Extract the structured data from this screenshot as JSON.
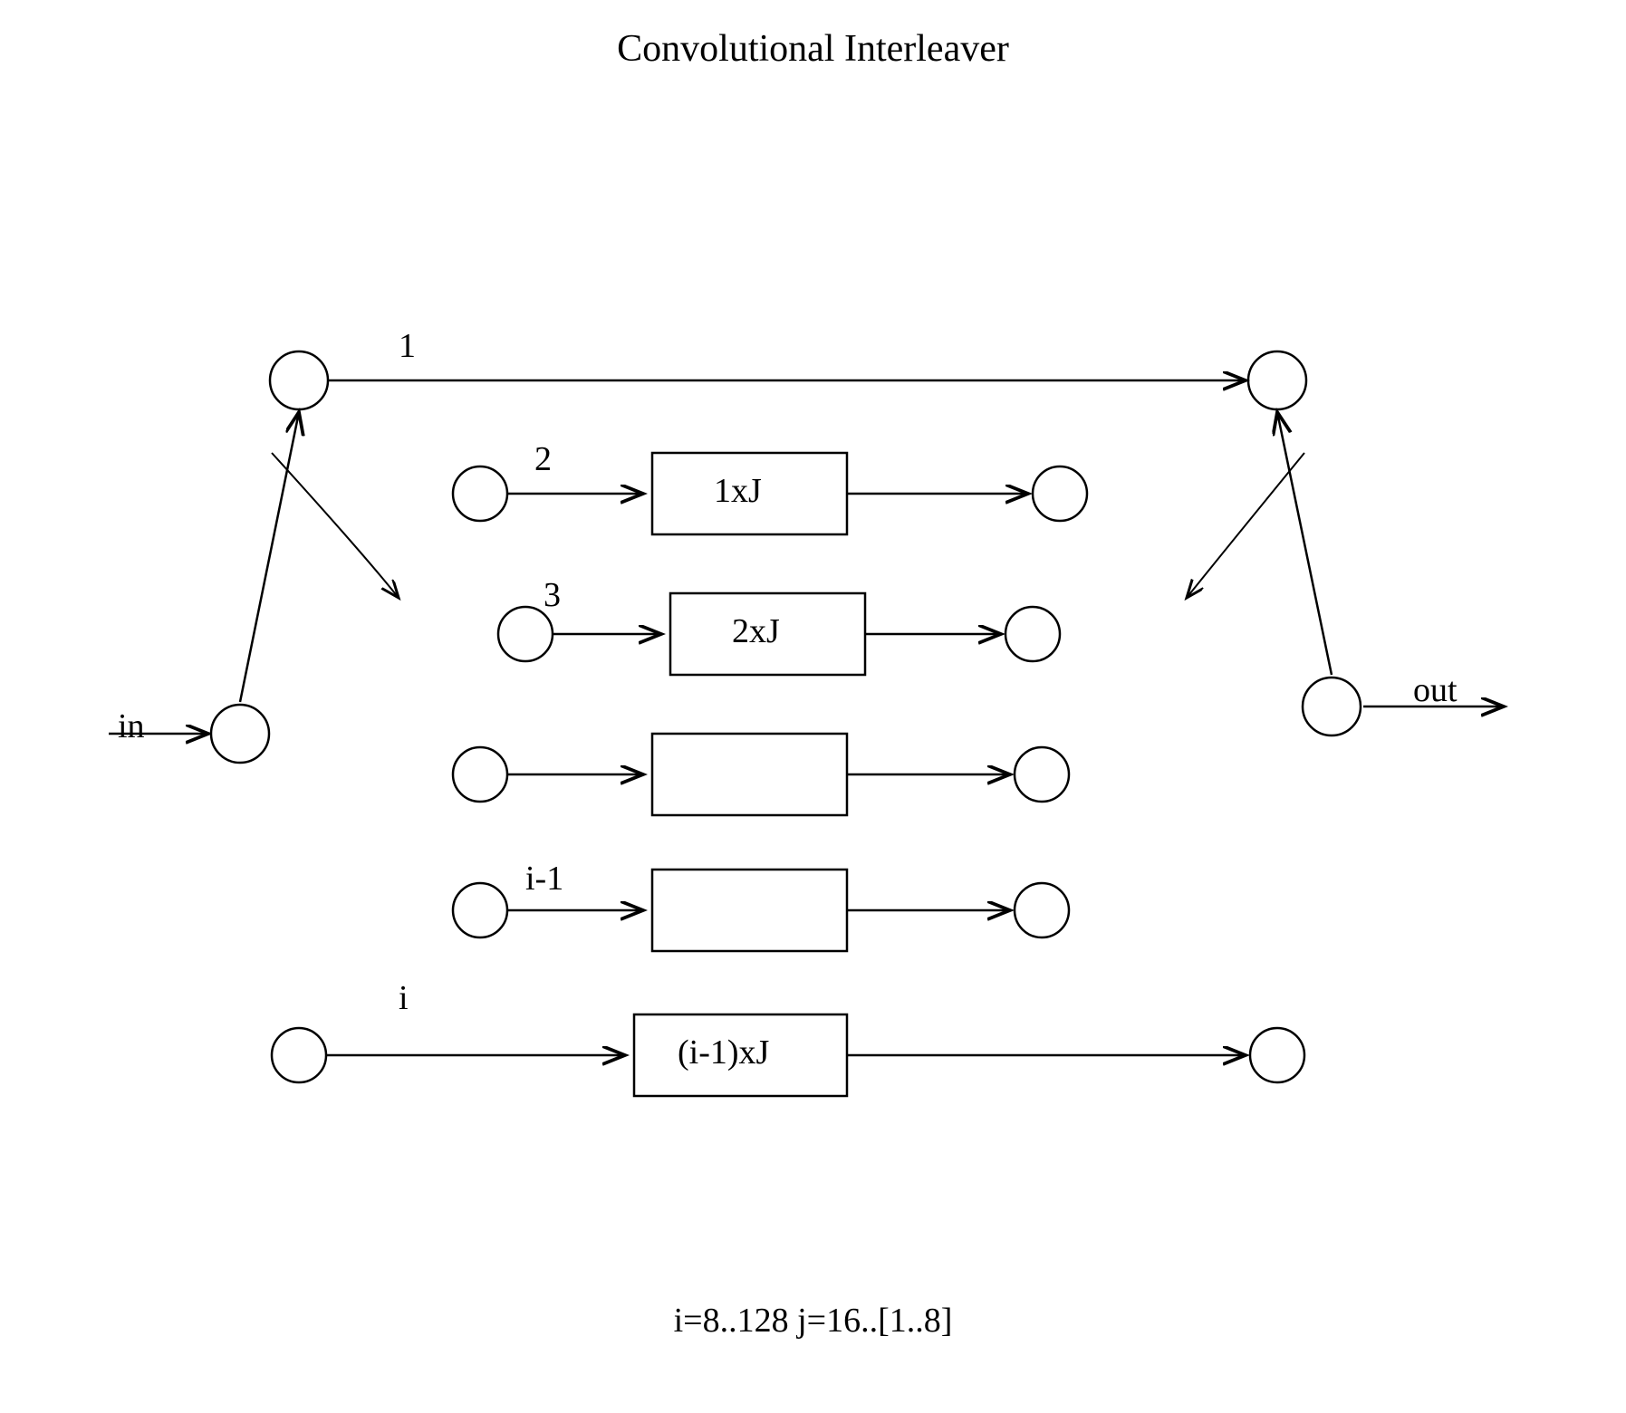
{
  "title": "Convolutional Interleaver",
  "labels": {
    "in": "in",
    "out": "out",
    "branch1": "1",
    "branch2": "2",
    "branch3": "3",
    "branchIm1": "i-1",
    "branchI": "i",
    "box1": "1xJ",
    "box2": "2xJ",
    "box3": "",
    "box4": "",
    "box5": "(i-1)xJ"
  },
  "footer": "i=8..128  j=16..[1..8]"
}
